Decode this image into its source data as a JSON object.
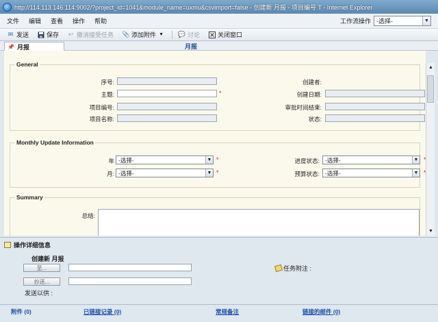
{
  "window": {
    "title": "http://114.113.146.114:9002/?project_id=1041&module_name=uxmu&csvimport=false - 创建新 月报 - 项目编号 T - Internet Explorer"
  },
  "menu": {
    "items": [
      "文件",
      "编辑",
      "查看",
      "操作",
      "帮助"
    ],
    "workflow_label": "工作流操作",
    "workflow_value": "-选择-"
  },
  "toolbar": {
    "send": "发送",
    "save": "保存",
    "cancel_accept": "撤消接受任务",
    "add_attachment": "添加附件",
    "discuss": "讨论",
    "close_window": "关闭窗口"
  },
  "tab": {
    "label": "月报",
    "center_title": "月报"
  },
  "general": {
    "legend": "General",
    "seq_label": "序号:",
    "subject_label": "主题:",
    "project_no_label": "项目编号:",
    "project_name_label": "项目名称:",
    "creator_label": "创建者:",
    "created_date_label": "创建日期:",
    "approval_end_label": "审批时间结束:",
    "status_label": "状态:"
  },
  "monthly": {
    "legend": "Monthly Update Information",
    "year_label": "年",
    "year_value": "-选择-",
    "month_label": "月:",
    "month_value": "-选择-",
    "progress_label": "进度状态:",
    "progress_value": "-选择-",
    "budget_label": "预算状态:",
    "budget_value": "-选择-"
  },
  "summary": {
    "legend": "Summary",
    "total_label": "总结:"
  },
  "details": {
    "header": "操作详细信息",
    "subtitle": "创建新 月报",
    "to_button": "至...",
    "cc_button": "抄送...",
    "send_for_label": "发送以供 :",
    "task_note_label": "任务附注 :"
  },
  "footer": {
    "attachments": "附件 (0)",
    "linked_records": "已链接记录 (0)",
    "regular_notes": "常规备注",
    "linked_emails": "链接的邮件 (0)"
  },
  "required_mark": "*"
}
